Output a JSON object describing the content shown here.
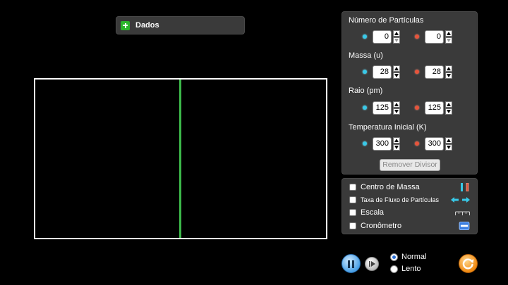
{
  "data_accordion": {
    "label": "Dados"
  },
  "control_panel": {
    "particles": {
      "title": "Número de Partículas",
      "cyan_value": "0",
      "red_value": "0"
    },
    "mass": {
      "title": "Massa (u)",
      "cyan_value": "28",
      "red_value": "28"
    },
    "radius": {
      "title": "Raio (pm)",
      "cyan_value": "125",
      "red_value": "125"
    },
    "temperature": {
      "title": "Temperatura Inicial (K)",
      "cyan_value": "300",
      "red_value": "300"
    },
    "remove_divider_label": "Remover Divisor"
  },
  "options": {
    "center_of_mass": "Centro de Massa",
    "particle_flow_rate": "Taxa de Fluxo de Partículas",
    "ruler": "Escala",
    "stopwatch": "Cronômetro"
  },
  "time_speed": {
    "normal": "Normal",
    "slow": "Lento",
    "selected": "Normal"
  },
  "colors": {
    "cyan_particle": "#38c9e8",
    "red_particle": "#e8533a",
    "divider": "#3cb84a",
    "panel": "#3a3a3a"
  },
  "icons": [
    "plus-icon",
    "pause-icon",
    "step-icon",
    "reset-icon",
    "center-of-mass-icon",
    "flow-rate-icon",
    "ruler-icon",
    "stopwatch-icon"
  ]
}
